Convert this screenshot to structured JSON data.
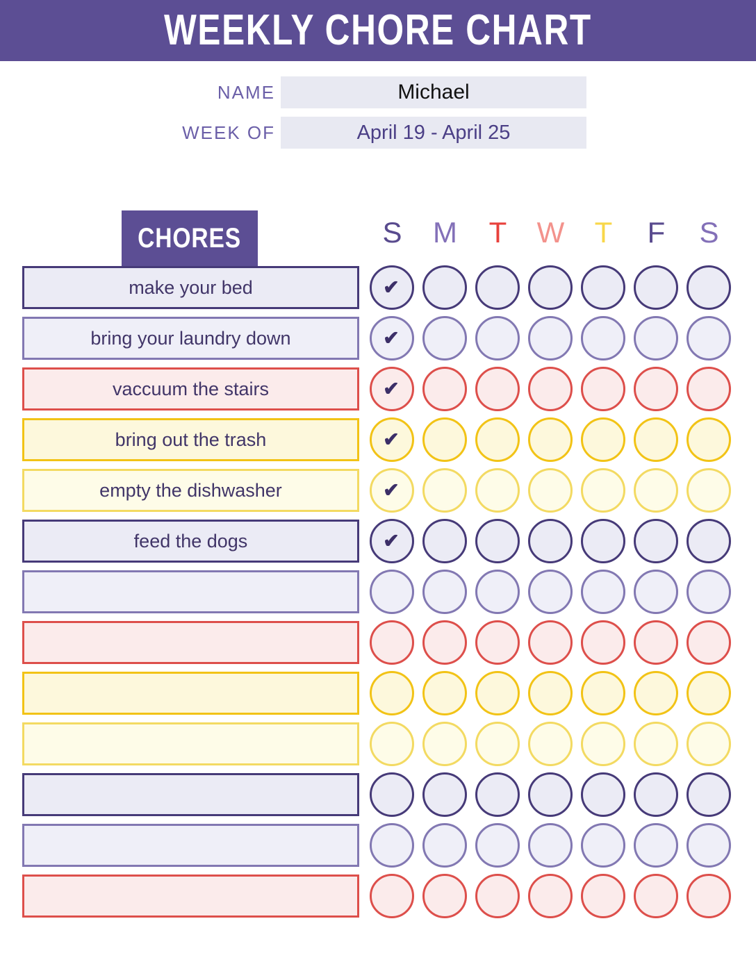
{
  "title": "WEEKLY CHORE CHART",
  "meta": {
    "name_label": "NAME",
    "name_value": "Michael",
    "week_label": "WEEK OF",
    "week_value": "April 19 - April 25"
  },
  "chores_header": "CHORES",
  "days": [
    {
      "letter": "S",
      "color": "#594B8E"
    },
    {
      "letter": "M",
      "color": "#8370B8"
    },
    {
      "letter": "T",
      "color": "#E8413C"
    },
    {
      "letter": "W",
      "color": "#F3928C"
    },
    {
      "letter": "T",
      "color": "#F8D749"
    },
    {
      "letter": "F",
      "color": "#594B8E"
    },
    {
      "letter": "S",
      "color": "#8370B8"
    }
  ],
  "check_glyph": "✔",
  "palette": {
    "banner_purple": "#5C4E94",
    "deep_purple": "#463A78",
    "mid_purple": "#8278B2",
    "red": "#DD4F4B",
    "salmon": "#E8706B",
    "gold": "#F2C316",
    "light_yellow": "#F3DA62",
    "fill_purple": "#EBEBF5",
    "fill_red": "#FBEBEB",
    "fill_gold": "#FDF8DC",
    "fill_yellow": "#FEFCE8",
    "text_purple": "#413568",
    "field_grey": "#E8E9F2"
  },
  "rows": [
    {
      "label": "make your bed",
      "border": "#463A78",
      "fill": "#EBEBF5",
      "checks": [
        true,
        false,
        false,
        false,
        false,
        false,
        false
      ]
    },
    {
      "label": "bring your laundry down",
      "border": "#8278B2",
      "fill": "#EFEFF8",
      "checks": [
        true,
        false,
        false,
        false,
        false,
        false,
        false
      ]
    },
    {
      "label": "vaccuum the stairs",
      "border": "#DD4F4B",
      "fill": "#FBEBEB",
      "checks": [
        true,
        false,
        false,
        false,
        false,
        false,
        false
      ]
    },
    {
      "label": "bring out the trash",
      "border": "#F2C316",
      "fill": "#FDF8DC",
      "checks": [
        true,
        false,
        false,
        false,
        false,
        false,
        false
      ]
    },
    {
      "label": "empty the dishwasher",
      "border": "#F3DA62",
      "fill": "#FEFCE8",
      "checks": [
        true,
        false,
        false,
        false,
        false,
        false,
        false
      ]
    },
    {
      "label": "feed the dogs",
      "border": "#463A78",
      "fill": "#EBEBF5",
      "checks": [
        true,
        false,
        false,
        false,
        false,
        false,
        false
      ]
    },
    {
      "label": "",
      "border": "#8278B2",
      "fill": "#EFEFF8",
      "checks": [
        false,
        false,
        false,
        false,
        false,
        false,
        false
      ]
    },
    {
      "label": "",
      "border": "#DD4F4B",
      "fill": "#FBEBEB",
      "checks": [
        false,
        false,
        false,
        false,
        false,
        false,
        false
      ]
    },
    {
      "label": "",
      "border": "#F2C316",
      "fill": "#FDF8DC",
      "checks": [
        false,
        false,
        false,
        false,
        false,
        false,
        false
      ]
    },
    {
      "label": "",
      "border": "#F3DA62",
      "fill": "#FEFCE8",
      "checks": [
        false,
        false,
        false,
        false,
        false,
        false,
        false
      ]
    },
    {
      "label": "",
      "border": "#463A78",
      "fill": "#EBEBF5",
      "checks": [
        false,
        false,
        false,
        false,
        false,
        false,
        false
      ]
    },
    {
      "label": "",
      "border": "#8278B2",
      "fill": "#EFEFF8",
      "checks": [
        false,
        false,
        false,
        false,
        false,
        false,
        false
      ]
    },
    {
      "label": "",
      "border": "#DD4F4B",
      "fill": "#FBEBEB",
      "checks": [
        false,
        false,
        false,
        false,
        false,
        false,
        false
      ]
    }
  ]
}
